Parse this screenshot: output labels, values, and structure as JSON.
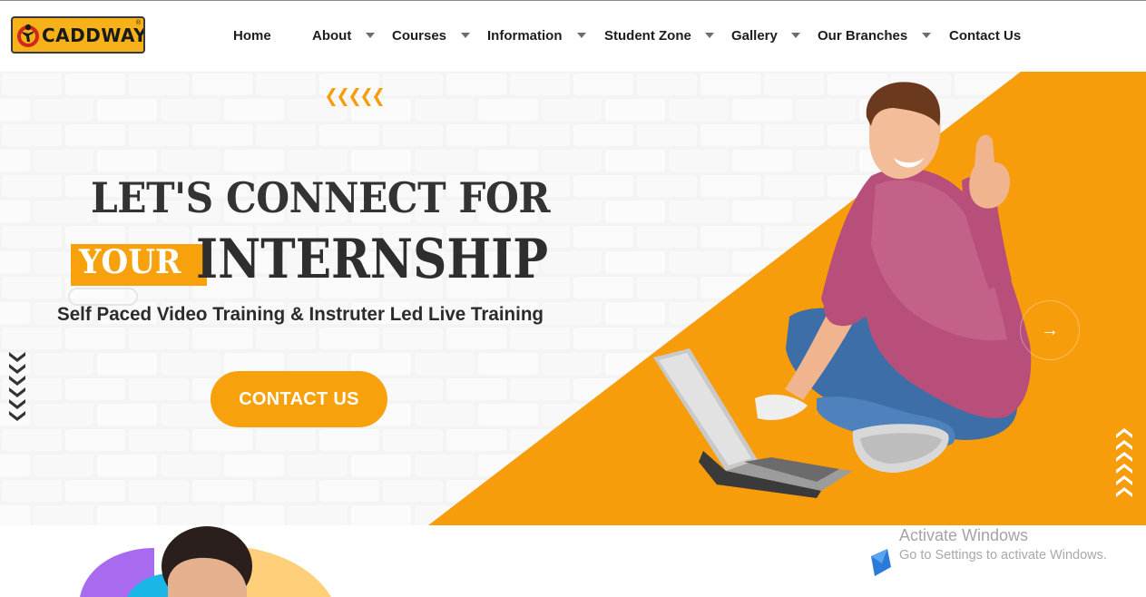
{
  "brand": {
    "name": "CADDWAY",
    "reg_mark": "®",
    "accent_color": "#f7a20c",
    "logo_bg": "#f7b21a"
  },
  "nav": {
    "items": [
      {
        "label": "Home",
        "has_dropdown": false
      },
      {
        "label": "About",
        "has_dropdown": true
      },
      {
        "label": "Courses",
        "has_dropdown": true
      },
      {
        "label": "Information",
        "has_dropdown": true
      },
      {
        "label": "Student Zone",
        "has_dropdown": true
      },
      {
        "label": "Gallery",
        "has_dropdown": true
      },
      {
        "label": "Our Branches",
        "has_dropdown": true
      },
      {
        "label": "Contact Us",
        "has_dropdown": false
      }
    ]
  },
  "hero": {
    "headline_line1": "LET'S CONNECT FOR",
    "headline_highlight": "YOUR",
    "headline_line2": "INTERNSHIP",
    "subtitle": "Self Paced Video Training & Instruter Led Live Training",
    "cta_label": "CONTACT US",
    "next_icon": "→",
    "image_subject": "smiling student sitting with laptop giving thumbs up"
  },
  "watermark": {
    "title": "Activate Windows",
    "subtitle": "Go to Settings to activate Windows."
  }
}
